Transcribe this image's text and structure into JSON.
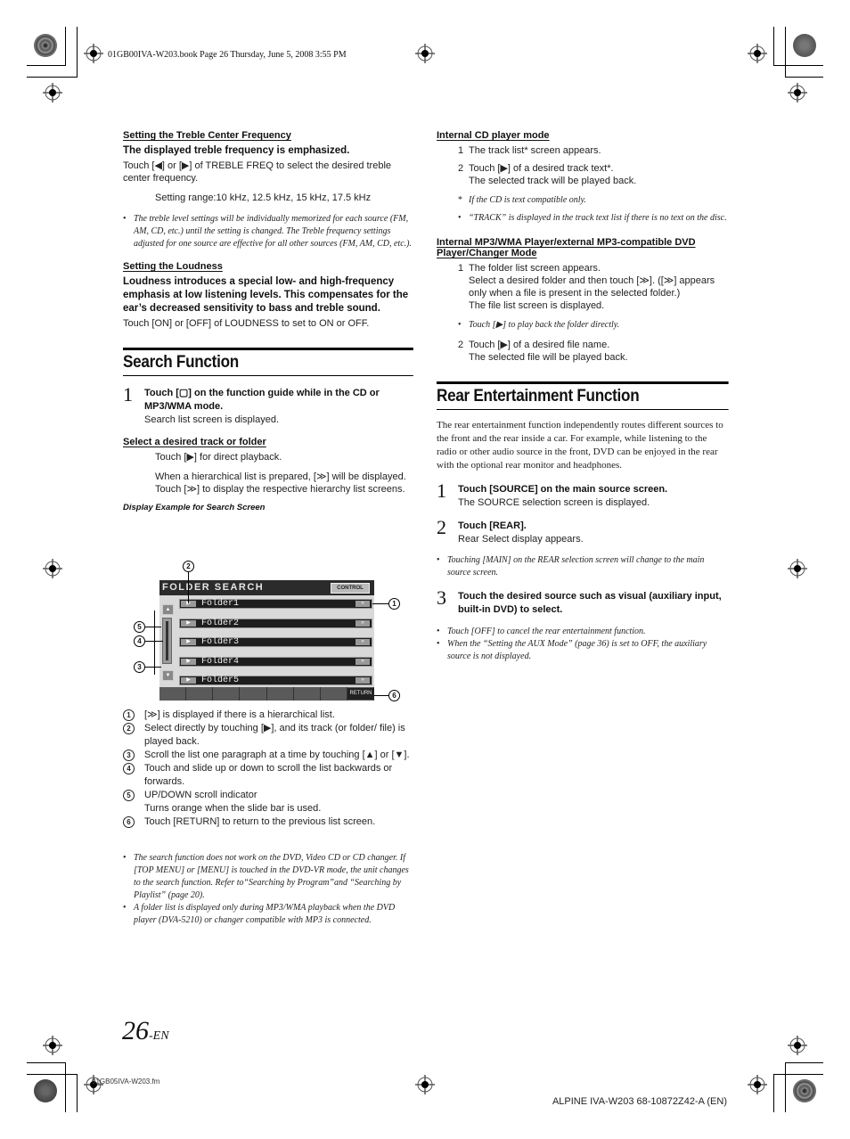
{
  "header": {
    "book_info": "01GB00IVA-W203.book  Page 26  Thursday, June 5, 2008  3:55 PM"
  },
  "left": {
    "treble": {
      "heading": "Setting the Treble Center Frequency",
      "lead": "The displayed treble frequency is emphasized.",
      "body": "Touch [◀] or [▶] of TREBLE FREQ to select the desired treble center frequency.",
      "range": "Setting range:10 kHz, 12.5 kHz, 15 kHz, 17.5 kHz",
      "note": "The treble level settings will be individually memorized for each source (FM, AM, CD, etc.) until the setting is changed. The Treble frequency settings adjusted for one source are effective for all other sources (FM, AM, CD, etc.)."
    },
    "loudness": {
      "heading": "Setting the Loudness",
      "lead": "Loudness introduces a special low- and high-frequency emphasis at low listening levels. This compensates for the ear’s decreased sensitivity to bass and treble sound.",
      "body": "Touch [ON] or [OFF] of LOUDNESS to set to ON or OFF."
    },
    "search": {
      "title": "Search Function",
      "step1_num": "1",
      "step1_title": "Touch [▢] on the function guide while in the CD or MP3/WMA mode.",
      "step1_body": "Search list screen is displayed.",
      "select_heading": "Select a desired track or folder",
      "select_p1": "Touch [▶] for direct playback.",
      "select_p2": "When a hierarchical list is prepared, [≫] will be displayed. Touch [≫] to display the respective hierarchy list screens.",
      "display_caption": "Display Example for Search Screen"
    },
    "screen": {
      "title": "FOLDER SEARCH",
      "control": "CONTROL",
      "play": "▶",
      "more": "»",
      "up": "▲",
      "down": "▼",
      "return": "RETURN",
      "items": [
        "Folder1",
        "Folder2",
        "Folder3",
        "Folder4",
        "Folder5"
      ]
    },
    "callouts": [
      {
        "n": "1",
        "text": "[≫] is displayed if there is a hierarchical list."
      },
      {
        "n": "2",
        "text": "Select directly by touching [▶], and its track (or folder/ file) is played back."
      },
      {
        "n": "3",
        "text": "Scroll the list one paragraph at a time by touching [▲] or [▼]."
      },
      {
        "n": "4",
        "text": "Touch and slide up or down to scroll the list backwards or forwards."
      },
      {
        "n": "5",
        "text": "UP/DOWN scroll indicator"
      },
      {
        "n": "5b",
        "text": "Turns orange when the slide bar is used."
      },
      {
        "n": "6",
        "text": "Touch [RETURN] to return to the previous list screen."
      }
    ],
    "notes": [
      "The search function does not work on the DVD, Video CD or CD changer. If [TOP MENU] or [MENU] is touched in the DVD-VR mode, the unit changes to the search function. Refer to“Searching by Program”and “Searching by Playlist” (page 20).",
      "A folder list is displayed only during MP3/WMA playback when the DVD player (DVA-5210) or changer compatible with MP3 is connected."
    ]
  },
  "right": {
    "cd": {
      "heading": "Internal CD player mode",
      "steps": [
        {
          "n": "1",
          "lines": [
            "The track list* screen appears."
          ]
        },
        {
          "n": "2",
          "lines": [
            "Touch [▶] of a desired track text*.",
            "The selected track will be played back."
          ]
        }
      ],
      "star_note": "If the CD is text compatible only.",
      "note": "“TRACK” is displayed in the track text list if there is no text on the disc."
    },
    "mp3": {
      "heading_line1": "Internal MP3/WMA Player/external MP3-compatible DVD",
      "heading_line2": "Player/Changer Mode",
      "step1": {
        "n": "1",
        "lines": [
          "The folder list screen appears.",
          "Select a desired folder and then touch [≫]. ([≫] appears only when a file is present in the selected folder.)",
          "The file list screen is displayed."
        ]
      },
      "note": "Touch [▶] to play back the folder directly.",
      "step2": {
        "n": "2",
        "lines": [
          "Touch [▶] of a desired file name.",
          "The selected file will be played back."
        ]
      }
    },
    "rear": {
      "title": "Rear Entertainment Function",
      "intro": "The rear entertainment function independently routes different sources to the front and the rear inside a car.  For example, while listening to the radio or other audio source in the front, DVD can be enjoyed in the rear with the optional rear monitor and headphones.",
      "step1_num": "1",
      "step1_title": "Touch [SOURCE] on the main source screen.",
      "step1_body": "The SOURCE selection screen is displayed.",
      "step2_num": "2",
      "step2_title": "Touch [REAR].",
      "step2_body": "Rear Select display appears.",
      "note_main": "Touching [MAIN] on the REAR selection screen will change to the main source screen.",
      "step3_num": "3",
      "step3_title": "Touch the desired source such as visual (auxiliary input, built-in DVD) to select.",
      "notes": [
        "Touch [OFF] to cancel the rear entertainment function.",
        "When the “Setting the AUX Mode” (page 36) is set to OFF, the auxiliary source is not displayed."
      ]
    }
  },
  "footer": {
    "page_number": "26",
    "page_suffix": "-EN",
    "file": "01GB05IVA-W203.fm",
    "model": "ALPINE IVA-W203 68-10872Z42-A (EN)"
  }
}
